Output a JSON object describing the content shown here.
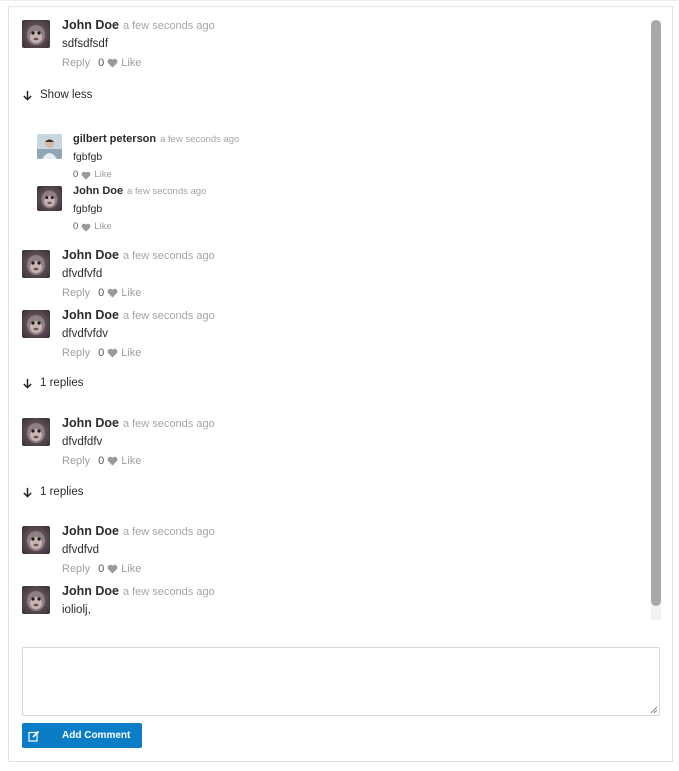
{
  "comments": [
    {
      "author": "John Doe",
      "time": "a few seconds ago",
      "text": "sdfsdfsdf",
      "reply": "Reply",
      "likes": "0",
      "like": "Like"
    },
    {
      "author": "John Doe",
      "time": "a few seconds ago",
      "text": "dfvdfvfd",
      "reply": "Reply",
      "likes": "0",
      "like": "Like"
    },
    {
      "author": "John Doe",
      "time": "a few seconds ago",
      "text": "dfvdfvfdv",
      "reply": "Reply",
      "likes": "0",
      "like": "Like"
    },
    {
      "author": "John Doe",
      "time": "a few seconds ago",
      "text": "dfvdfdfv",
      "reply": "Reply",
      "likes": "0",
      "like": "Like"
    },
    {
      "author": "John Doe",
      "time": "a few seconds ago",
      "text": "dfvdfvd",
      "reply": "Reply",
      "likes": "0",
      "like": "Like"
    },
    {
      "author": "John Doe",
      "time": "a few seconds ago",
      "text": "ioliolj,"
    }
  ],
  "replies": [
    {
      "author": "gilbert peterson",
      "time": "a few seconds ago",
      "text": "fgbfgb",
      "likes": "0",
      "like": "Like"
    },
    {
      "author": "John Doe",
      "time": "a few seconds ago",
      "text": "fgbfgb",
      "likes": "0",
      "like": "Like"
    }
  ],
  "toggles": {
    "show_less": "Show less",
    "replies_1": "1 replies",
    "replies_2": "1 replies"
  },
  "composer": {
    "placeholder": "",
    "button": "Add Comment"
  },
  "colors": {
    "accent": "#0b7dc7"
  }
}
